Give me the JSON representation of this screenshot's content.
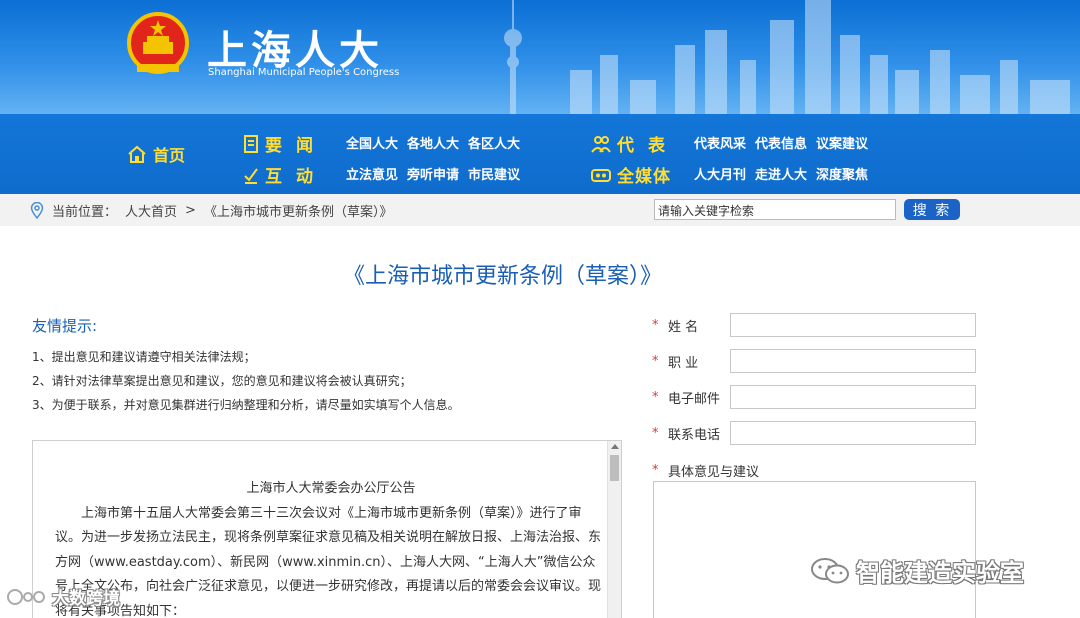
{
  "header": {
    "title": "上海人大",
    "subtitle": "Shanghai Municipal People's Congress"
  },
  "nav": {
    "home": "首页",
    "news": {
      "label": "要闻",
      "links": [
        "全国人大",
        "各地人大",
        "各区人大"
      ]
    },
    "interact": {
      "label": "互动",
      "links": [
        "立法意见",
        "旁听申请",
        "市民建议"
      ]
    },
    "deputies": {
      "label": "代表",
      "links": [
        "代表风采",
        "代表信息",
        "议案建议"
      ]
    },
    "media": {
      "label": "全媒体",
      "links": [
        "人大月刊",
        "走进人大",
        "深度聚焦"
      ]
    }
  },
  "breadcrumb": {
    "prefix": "当前位置：",
    "home": "人大首页",
    "separator": ">",
    "current": "《上海市城市更新条例（草案）》"
  },
  "search": {
    "value": "请输入关键字检索",
    "button": "搜 索"
  },
  "page": {
    "title": "《上海市城市更新条例（草案）》",
    "tips_title": "友情提示:",
    "tips": [
      "1、提出意见和建议请遵守相关法律法规；",
      "2、请针对法律草案提出意见和建议，您的意见和建议将会被认真研究；",
      "3、为便于联系，并对意见集群进行归纳整理和分析，请尽量如实填写个人信息。"
    ]
  },
  "notice": {
    "heading": "上海市人大常委会办公厅公告",
    "body": "上海市第十五届人大常委会第三十三次会议对《上海市城市更新条例（草案）》进行了审议。为进一步发扬立法民主，现将条例草案征求意见稿及相关说明在解放日报、上海法治报、东方网（www.eastday.com）、新民网（www.xinmin.cn）、上海人大网、“上海人大”微信公众号上全文公布，向社会广泛征求意见，以便进一步研究修改，再提请以后的常委会会议审议。现将有关事项告知如下："
  },
  "form": {
    "required_mark": "*",
    "fields": [
      "姓 名",
      "职 业",
      "电子邮件",
      "联系电话"
    ],
    "opinion_label": "具体意见与建议"
  },
  "watermarks": {
    "wechat": "智能建造实验室",
    "corner": "大数跨境"
  },
  "colors": {
    "banner_blue": "#0b6fd4",
    "nav_blue": "#1376d8",
    "nav_highlight": "#ffdd33",
    "title_blue": "#1a5fb4",
    "required_red": "#d23b3b",
    "search_button": "#1b63c6"
  },
  "icons": {
    "emblem": "national-emblem-icon",
    "home": "home-icon",
    "news": "document-icon",
    "interact": "pencil-check-icon",
    "deputies": "people-icon",
    "media": "media-icon",
    "location": "location-pin-icon",
    "wechat": "wechat-icon"
  }
}
